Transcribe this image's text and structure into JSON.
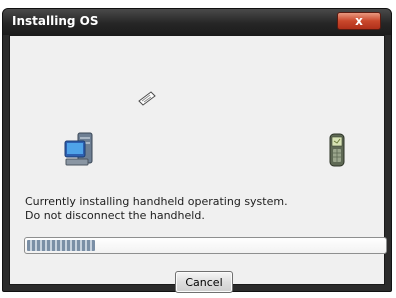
{
  "window": {
    "title": "Installing OS",
    "close_glyph": "x"
  },
  "icons": {
    "source": "computer-icon",
    "transfer": "document-transfer-icon",
    "target": "handheld-device-icon"
  },
  "message": {
    "line1": "Currently installing handheld operating system.",
    "line2": "Do not disconnect the handheld."
  },
  "progress": {
    "fraction": 0.19
  },
  "buttons": {
    "cancel_label": "Cancel"
  },
  "colors": {
    "titlebar": "#262626",
    "close_button": "#c9472b",
    "client_background": "#f0f0f0",
    "progress_segment": "#7a8fa6"
  }
}
